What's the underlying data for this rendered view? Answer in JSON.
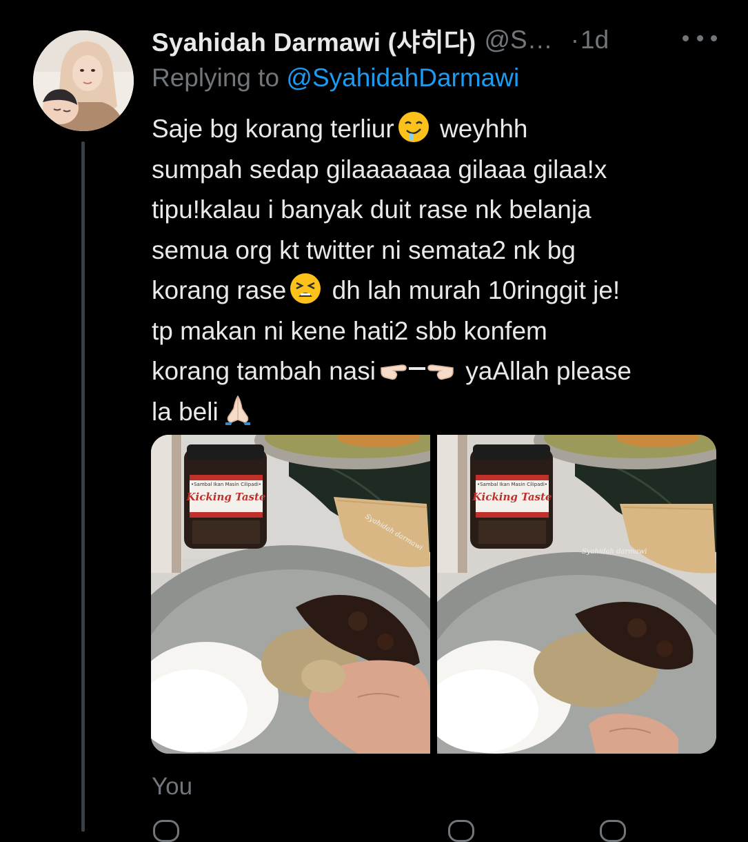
{
  "tweet": {
    "display_name": "Syahidah Darmawi (샤히다)",
    "handle": "@S…",
    "separator": "·",
    "time": "1d",
    "reply_prefix": "Replying to ",
    "reply_handle": "@SyahidahDarmawi",
    "text_lines": [
      "Saje bg korang terliur",
      " weyhhh\nsumpah sedap gilaaaaaaa gilaaa gilaa!x\ntipu!kalau i banyak duit rase nk belanja\nsemua org kt twitter ni semata2 nk bg\nkorang rase",
      " dh lah murah 10ringgit je!\ntp makan ni kene hati2 sbb konfem\nkorang tambah nasi",
      " yaAllah please\nla beli"
    ],
    "emojis": [
      "drooling-face-icon",
      "tired-face-icon",
      "pointing-fingers-icon",
      "folded-hands-icon"
    ],
    "attached_label": "You"
  },
  "photos": [
    {
      "jar_label_line1": "•Sambal Ikan Masin Cilipadi•",
      "jar_brand": "Kicking Taste",
      "watermark": "Syahidah darmawi"
    },
    {
      "jar_label_line1": "•Sambal Ikan Masin Cilipadi•",
      "jar_brand": "Kicking Taste",
      "watermark": "Syahidah darmawi"
    }
  ],
  "colors": {
    "background": "#000000",
    "text_primary": "#e7e9ea",
    "text_secondary": "#71767b",
    "link": "#1d9bf0"
  }
}
